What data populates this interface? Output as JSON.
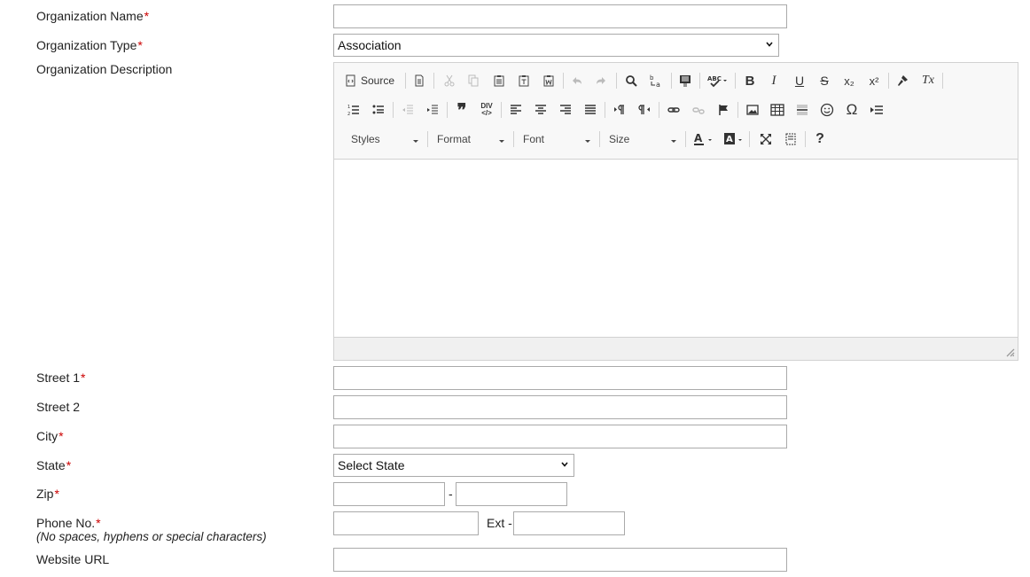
{
  "labels": {
    "org_name": "Organization Name",
    "org_type": "Organization Type",
    "org_desc": "Organization Description",
    "street1": "Street 1",
    "street2": "Street 2",
    "city": "City",
    "state": "State",
    "zip": "Zip",
    "phone": "Phone No.",
    "phone_note": "(No spaces, hyphens or special characters)",
    "website": "Website URL",
    "required_mark": "*"
  },
  "fields": {
    "org_type_selected": "Association",
    "state_selected": "Select State",
    "zip_separator": "-",
    "ext_label": "Ext -"
  },
  "editor": {
    "source_label": "Source",
    "styles_label": "Styles",
    "format_label": "Format",
    "font_label": "Font",
    "size_label": "Size",
    "bold": "B",
    "italic": "I",
    "underline": "U",
    "strike": "S",
    "subscript": "x₂",
    "superscript": "x²",
    "removeformat": "Tx",
    "blockquote": "❞",
    "creatediv": "DIV",
    "specialchar": "Ω",
    "help": "?"
  }
}
